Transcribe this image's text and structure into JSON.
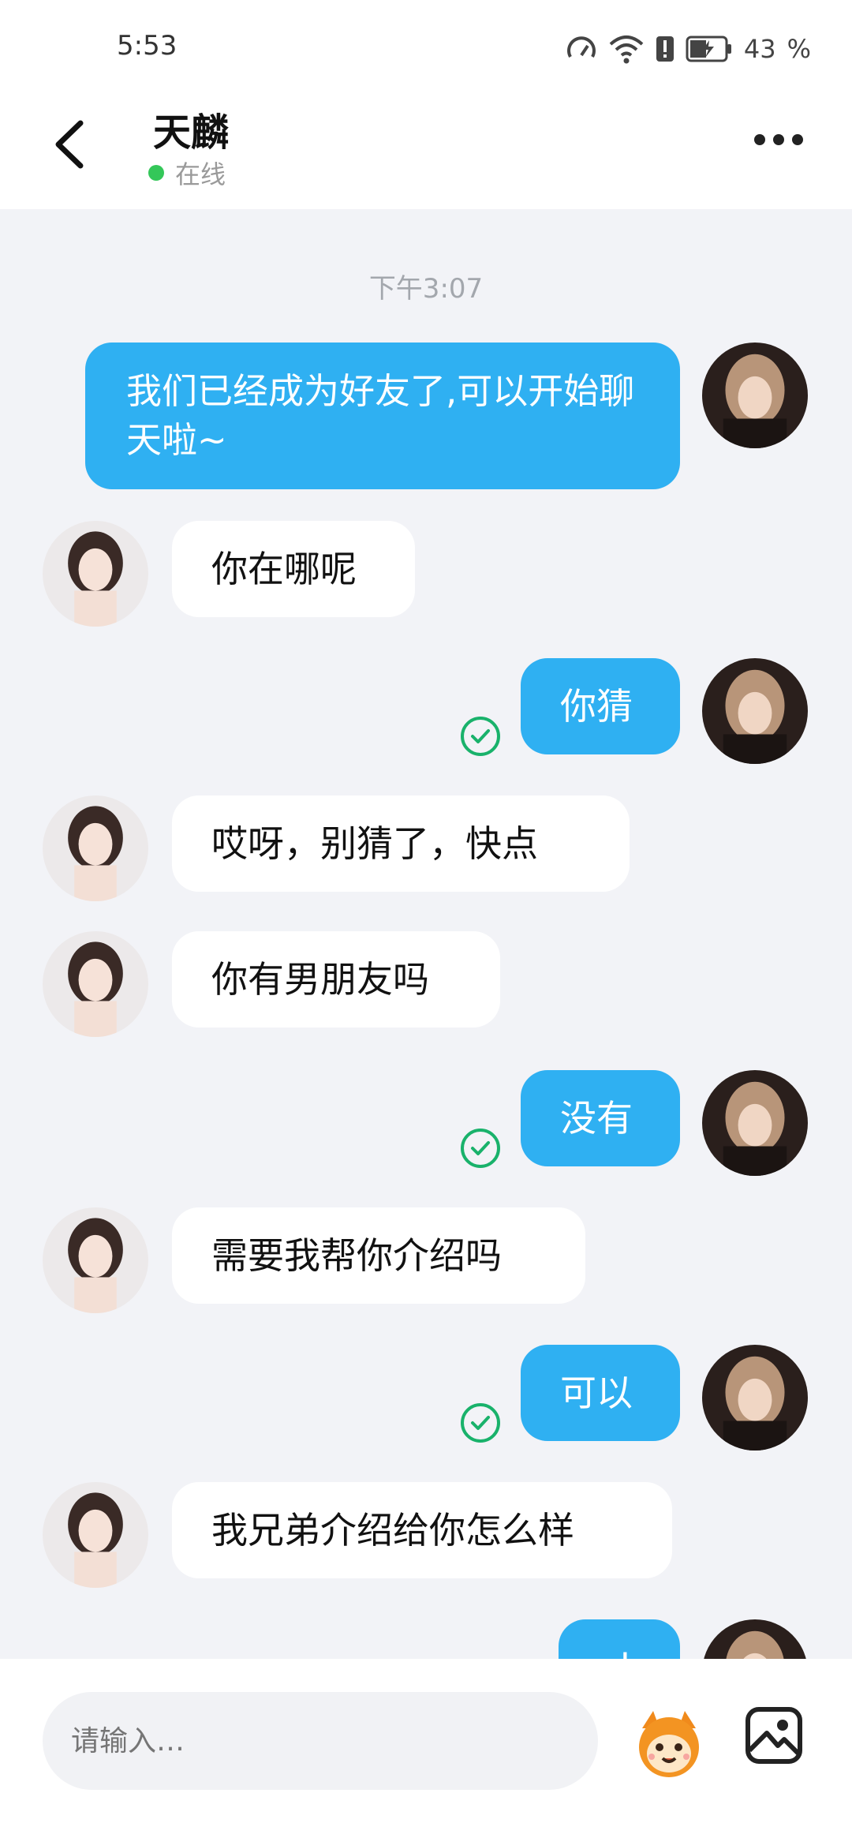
{
  "status_bar": {
    "time": "5:53",
    "battery": "43"
  },
  "header": {
    "contact_name": "天麟",
    "status": "在线"
  },
  "chat": {
    "timestamp": "下午3:07",
    "messages": [
      {
        "dir": "out",
        "text": "我们已经成为好友了,可以开始聊天啦~"
      },
      {
        "dir": "in",
        "text": "你在哪呢"
      },
      {
        "dir": "out",
        "text": "你猜"
      },
      {
        "dir": "in",
        "text": "哎呀，别猜了，快点"
      },
      {
        "dir": "in",
        "text": "你有男朋友吗"
      },
      {
        "dir": "out",
        "text": "没有"
      },
      {
        "dir": "in",
        "text": "需要我帮你介绍吗"
      },
      {
        "dir": "out",
        "text": "可以"
      },
      {
        "dir": "in",
        "text": "我兄弟介绍给你怎么样"
      },
      {
        "dir": "out",
        "text": "ok"
      }
    ]
  },
  "input": {
    "placeholder": "请输入…"
  },
  "colors": {
    "outgoing_bubble": "#2fb0f2",
    "incoming_bubble": "#ffffff",
    "online_dot": "#34c759",
    "read_check": "#19b26b"
  },
  "icons": [
    "back-icon",
    "more-icon",
    "read-check-icon",
    "emoji-icon",
    "image-icon",
    "avatar"
  ]
}
